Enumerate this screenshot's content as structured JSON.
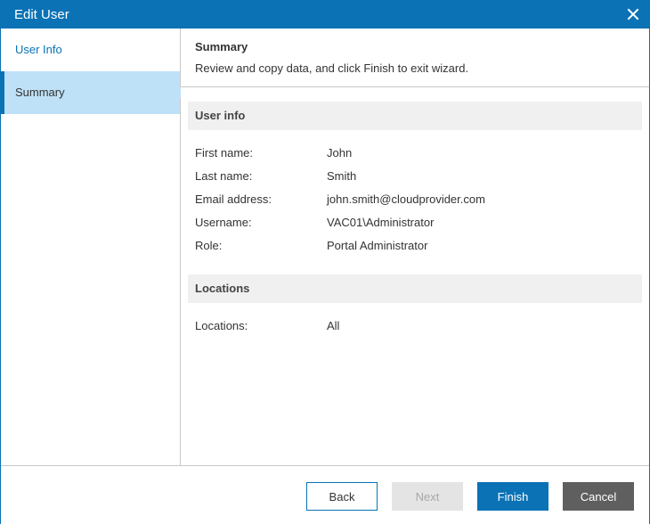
{
  "window": {
    "title": "Edit User",
    "close_icon": "close-icon"
  },
  "colors": {
    "accent": "#0a72b5",
    "active_step_bg": "#bfe1f8",
    "cancel_bg": "#5f5f5f",
    "disabled_bg": "#e4e4e4"
  },
  "steps": [
    {
      "label": "User Info",
      "active": false
    },
    {
      "label": "Summary",
      "active": true
    }
  ],
  "header": {
    "title": "Summary",
    "description": "Review and copy data, and click Finish to exit wizard."
  },
  "user_info": {
    "title": "User info",
    "rows": [
      {
        "key": "First name:",
        "value": "John"
      },
      {
        "key": "Last name:",
        "value": "Smith"
      },
      {
        "key": "Email address:",
        "value": "john.smith@cloudprovider.com"
      },
      {
        "key": "Username:",
        "value": "VAC01\\Administrator"
      },
      {
        "key": "Role:",
        "value": "Portal Administrator"
      }
    ]
  },
  "locations": {
    "title": "Locations",
    "rows": [
      {
        "key": "Locations:",
        "value": "All"
      }
    ]
  },
  "buttons": {
    "back": "Back",
    "next": "Next",
    "finish": "Finish",
    "cancel": "Cancel"
  }
}
